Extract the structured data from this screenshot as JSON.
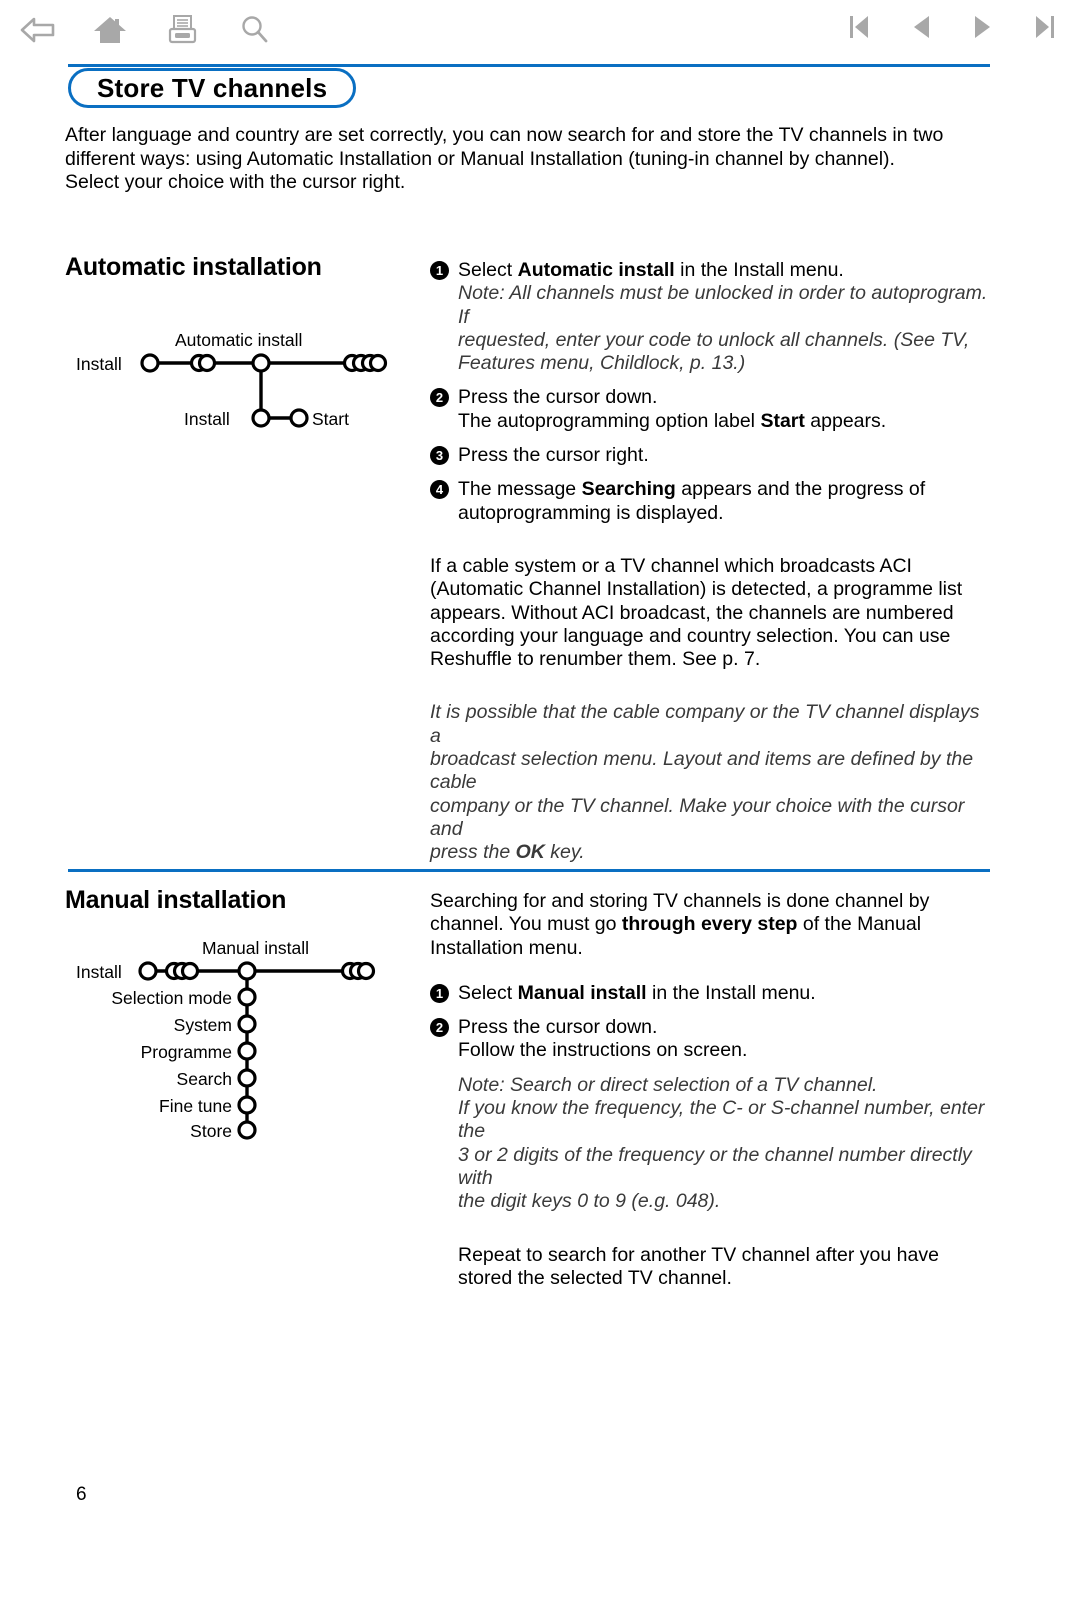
{
  "toolbar": {
    "left_icons": [
      {
        "name": "back-icon",
        "label": "Back"
      },
      {
        "name": "home-icon",
        "label": "Home"
      },
      {
        "name": "print-icon",
        "label": "Print"
      },
      {
        "name": "search-icon",
        "label": "Search"
      }
    ],
    "right_icons": [
      {
        "name": "first-page-icon",
        "label": "First page"
      },
      {
        "name": "previous-page-icon",
        "label": "Previous page"
      },
      {
        "name": "next-page-icon",
        "label": "Next page"
      },
      {
        "name": "last-page-icon",
        "label": "Last page"
      }
    ]
  },
  "header": {
    "title": "Store TV channels",
    "accent_color": "#0a6fc2"
  },
  "intro": {
    "line1": "After language and country are set correctly, you can now search for and store the TV channels in two",
    "line2": "different ways: using Automatic Installation or Manual Installation (tuning-in channel by channel).",
    "line3": "Select your choice with the cursor right."
  },
  "automatic": {
    "heading": "Automatic installation",
    "diagram": {
      "top_label": "Automatic install",
      "left_label": "Install",
      "branch_label": "Install",
      "branch_value": "Start"
    },
    "steps": [
      {
        "num": "1",
        "text_before": "Select ",
        "bold": "Automatic install",
        "text_after": " in the Install menu."
      },
      {
        "num": "2",
        "text_before": "Press the cursor down.",
        "bold": "",
        "text_after": ""
      },
      {
        "num": "3",
        "text_before": "Press the cursor right.",
        "bold": "",
        "text_after": ""
      },
      {
        "num": "4",
        "text_before": "The message ",
        "bold": "Searching",
        "text_after": " appears and the progress of"
      }
    ],
    "step1_note": {
      "line1": "Note: All channels must be unlocked in order to autoprogram. If",
      "line2": "requested, enter your code to unlock all channels. (See TV,",
      "line3": "Features menu, Childlock, p. 13.)"
    },
    "step2_sub_before": "The autoprogramming option label ",
    "step2_sub_bold": "Start",
    "step2_sub_after": " appears.",
    "step4_sub": "autoprogramming is displayed.",
    "aci_paragraph": {
      "line1": "If a cable system or a TV channel which broadcasts ACI",
      "line2": "(Automatic Channel Installation) is detected, a programme list",
      "line3": "appears. Without ACI broadcast, the channels are numbered",
      "line4": "according your language and country selection. You can use",
      "line5": "Reshuffle to renumber them. See p. 7."
    },
    "cable_note": {
      "line1": "It is possible that the cable company or the TV channel displays a",
      "line2": "broadcast selection menu. Layout and items are defined by the cable",
      "line3": "company or the TV channel. Make your choice with the cursor and",
      "line4_before": "press the ",
      "line4_bold": "OK",
      "line4_after": " key."
    }
  },
  "manual": {
    "heading": "Manual installation",
    "diagram": {
      "top_label": "Manual install",
      "left_label": "Install",
      "items": [
        "Selection mode",
        "System",
        "Programme",
        "Search",
        "Fine tune",
        "Store"
      ]
    },
    "intro": {
      "line1": "Searching for and storing TV channels is done channel by",
      "line2_before": "channel. You must go ",
      "line2_bold": "through every step",
      "line2_after": " of the Manual",
      "line3": "Installation menu."
    },
    "steps": [
      {
        "num": "1",
        "text_before": "Select ",
        "bold": "Manual install",
        "text_after": " in the Install menu."
      },
      {
        "num": "2",
        "text_before": "Press the cursor down.",
        "bold": "",
        "text_after": ""
      }
    ],
    "step2_sub": "Follow the instructions on screen.",
    "note": {
      "line1": "Note: Search or direct selection of a TV channel.",
      "line2": "If you know the frequency, the C- or S-channel number, enter the",
      "line3": "3 or 2 digits of the frequency or the channel number directly with",
      "line4": "the digit keys 0 to 9 (e.g. 048)."
    },
    "repeat": {
      "line1": "Repeat to search for another TV channel after you have",
      "line2": "stored the selected TV channel."
    }
  },
  "footer": {
    "page_number": "6"
  }
}
